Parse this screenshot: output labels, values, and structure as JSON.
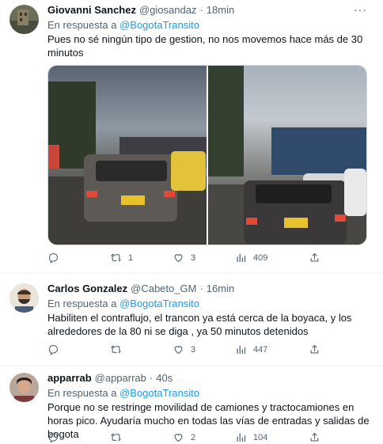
{
  "tweets": [
    {
      "name": "Giovanni Sanchez",
      "handle": "@giosandaz",
      "time": "18min",
      "reply_prefix": "En respuesta a",
      "reply_to": "@BogotaTransito",
      "text": "Pues no sé ningún tipo de gestion, no nos movemos hace más de 30 minutos",
      "replies": "",
      "retweets": "1",
      "likes": "3",
      "views": "409"
    },
    {
      "name": "Carlos Gonzalez",
      "handle": "@Cabeto_GM",
      "time": "16min",
      "reply_prefix": "En respuesta a",
      "reply_to": "@BogotaTransito",
      "text": "Habiliten el contraflujo,  el trancon ya está cerca de la boyaca, y los alrededores de la 80 ni se diga , ya 50 minutos detenidos",
      "replies": "",
      "retweets": "",
      "likes": "3",
      "views": "447"
    },
    {
      "name": "apparrab",
      "handle": "@apparrab",
      "time": "40s",
      "reply_prefix": "En respuesta a",
      "reply_to": "@BogotaTransito",
      "text": "Porque no se restringe movilidad de camiones y tractocamiones en horas pico. Ayudaría mucho en todas las vías de entradas y salidas de bogota",
      "replies": "",
      "retweets": "",
      "likes": "2",
      "views": "104"
    }
  ],
  "separator": "·",
  "more_glyph": "···",
  "icons": [
    "reply-icon",
    "retweet-icon",
    "like-icon",
    "views-icon",
    "share-icon",
    "more-icon"
  ],
  "colors": {
    "link": "#1d9bf0",
    "secondary": "#536471",
    "text": "#0f1419",
    "border": "#eff3f4"
  }
}
